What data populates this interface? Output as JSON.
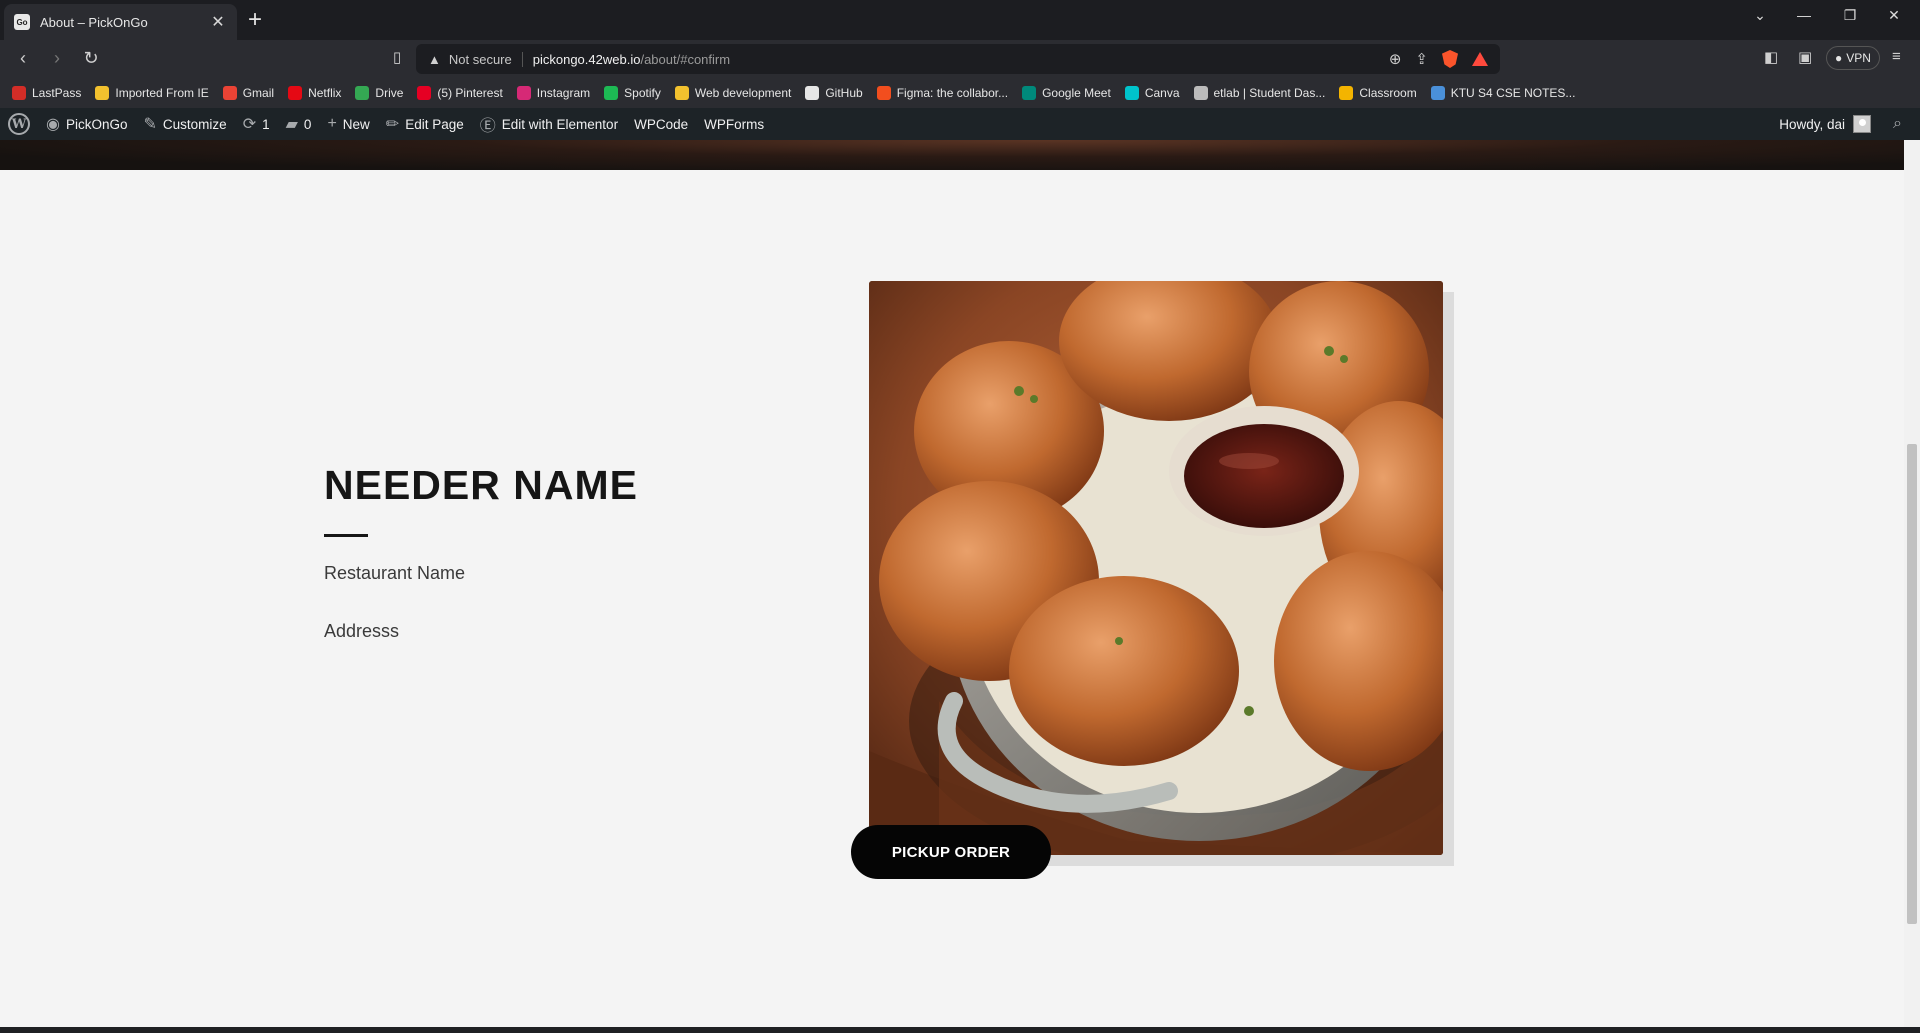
{
  "browser": {
    "tab_title": "About – PickOnGo",
    "favicon_text": "Go",
    "url_warning": "Not secure",
    "url_host": "pickongo.42web.io",
    "url_path": "/about/#confirm",
    "vpn_label": "VPN"
  },
  "bookmarks": [
    {
      "label": "LastPass",
      "color": "#d32d27"
    },
    {
      "label": "Imported From IE",
      "color": "#f2c12e"
    },
    {
      "label": "Gmail",
      "color": "#ea4335"
    },
    {
      "label": "Netflix",
      "color": "#e50914"
    },
    {
      "label": "Drive",
      "color": "#34a853"
    },
    {
      "label": "(5) Pinterest",
      "color": "#e60023"
    },
    {
      "label": "Instagram",
      "color": "#d62976"
    },
    {
      "label": "Spotify",
      "color": "#1db954"
    },
    {
      "label": "Web development",
      "color": "#f2c12e"
    },
    {
      "label": "GitHub",
      "color": "#e6e6e6"
    },
    {
      "label": "Figma: the collabor...",
      "color": "#f24e1e"
    },
    {
      "label": "Google Meet",
      "color": "#00897b"
    },
    {
      "label": "Canva",
      "color": "#00c4cc"
    },
    {
      "label": "etlab | Student Das...",
      "color": "#bbbbbb"
    },
    {
      "label": "Classroom",
      "color": "#f4b400"
    },
    {
      "label": "KTU S4 CSE NOTES...",
      "color": "#4a90d9"
    }
  ],
  "adminbar": {
    "site_name": "PickOnGo",
    "customize": "Customize",
    "updates_count": "1",
    "comments_count": "0",
    "new_label": "New",
    "edit_page": "Edit Page",
    "edit_elementor": "Edit with Elementor",
    "wpcode": "WPCode",
    "wpforms": "WPForms",
    "howdy": "Howdy, dai"
  },
  "content": {
    "heading": "NEEDER NAME",
    "restaurant_name": "Restaurant Name",
    "address": "Addresss",
    "button_label": "PICKUP ORDER",
    "image_alt": "fried chicken with dipping sauce"
  }
}
